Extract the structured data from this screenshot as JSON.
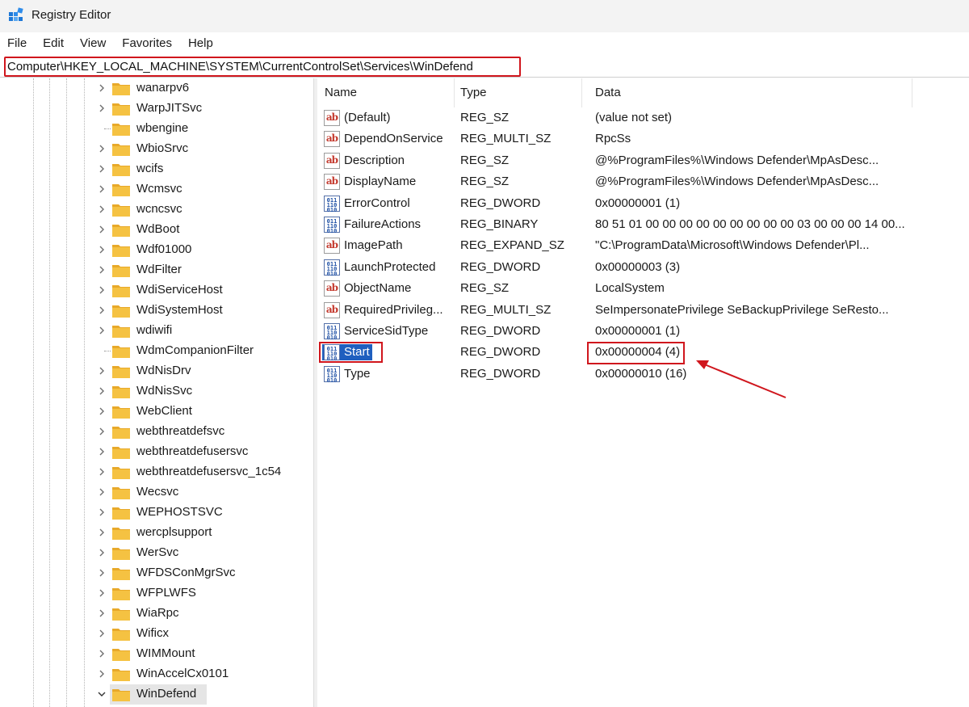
{
  "window": {
    "title": "Registry Editor",
    "icon": "registry-editor-icon"
  },
  "menu": [
    "File",
    "Edit",
    "View",
    "Favorites",
    "Help"
  ],
  "address": {
    "value": "Computer\\HKEY_LOCAL_MACHINE\\SYSTEM\\CurrentControlSet\\Services\\WinDefend"
  },
  "tree": {
    "items": [
      {
        "label": "wanarpv6",
        "expandable": true
      },
      {
        "label": "WarpJITSvc",
        "expandable": true
      },
      {
        "label": "wbengine",
        "expandable": false
      },
      {
        "label": "WbioSrvc",
        "expandable": true
      },
      {
        "label": "wcifs",
        "expandable": true
      },
      {
        "label": "Wcmsvc",
        "expandable": true
      },
      {
        "label": "wcncsvc",
        "expandable": true
      },
      {
        "label": "WdBoot",
        "expandable": true
      },
      {
        "label": "Wdf01000",
        "expandable": true
      },
      {
        "label": "WdFilter",
        "expandable": true
      },
      {
        "label": "WdiServiceHost",
        "expandable": true
      },
      {
        "label": "WdiSystemHost",
        "expandable": true
      },
      {
        "label": "wdiwifi",
        "expandable": true
      },
      {
        "label": "WdmCompanionFilter",
        "expandable": false
      },
      {
        "label": "WdNisDrv",
        "expandable": true
      },
      {
        "label": "WdNisSvc",
        "expandable": true
      },
      {
        "label": "WebClient",
        "expandable": true
      },
      {
        "label": "webthreatdefsvc",
        "expandable": true
      },
      {
        "label": "webthreatdefusersvc",
        "expandable": true
      },
      {
        "label": "webthreatdefusersvc_1c54",
        "expandable": true
      },
      {
        "label": "Wecsvc",
        "expandable": true
      },
      {
        "label": "WEPHOSTSVC",
        "expandable": true
      },
      {
        "label": "wercplsupport",
        "expandable": true
      },
      {
        "label": "WerSvc",
        "expandable": true
      },
      {
        "label": "WFDSConMgrSvc",
        "expandable": true
      },
      {
        "label": "WFPLWFS",
        "expandable": true
      },
      {
        "label": "WiaRpc",
        "expandable": true
      },
      {
        "label": "Wificx",
        "expandable": true
      },
      {
        "label": "WIMMount",
        "expandable": true
      },
      {
        "label": "WinAccelCx0101",
        "expandable": true
      },
      {
        "label": "WinDefend",
        "expandable": true,
        "expanded": true,
        "selected": true
      }
    ]
  },
  "list": {
    "columns": [
      "Name",
      "Type",
      "Data"
    ],
    "rows": [
      {
        "name": "(Default)",
        "type": "REG_SZ",
        "data": "(value not set)",
        "icon": "string-value-icon"
      },
      {
        "name": "DependOnService",
        "type": "REG_MULTI_SZ",
        "data": "RpcSs",
        "icon": "string-value-icon"
      },
      {
        "name": "Description",
        "type": "REG_SZ",
        "data": "@%ProgramFiles%\\Windows Defender\\MpAsDesc...",
        "icon": "string-value-icon"
      },
      {
        "name": "DisplayName",
        "type": "REG_SZ",
        "data": "@%ProgramFiles%\\Windows Defender\\MpAsDesc...",
        "icon": "string-value-icon"
      },
      {
        "name": "ErrorControl",
        "type": "REG_DWORD",
        "data": "0x00000001 (1)",
        "icon": "binary-value-icon"
      },
      {
        "name": "FailureActions",
        "type": "REG_BINARY",
        "data": "80 51 01 00 00 00 00 00 00 00 00 00 03 00 00 00 14 00...",
        "icon": "binary-value-icon"
      },
      {
        "name": "ImagePath",
        "type": "REG_EXPAND_SZ",
        "data": "\"C:\\ProgramData\\Microsoft\\Windows Defender\\Pl...",
        "icon": "string-value-icon"
      },
      {
        "name": "LaunchProtected",
        "type": "REG_DWORD",
        "data": "0x00000003 (3)",
        "icon": "binary-value-icon"
      },
      {
        "name": "ObjectName",
        "type": "REG_SZ",
        "data": "LocalSystem",
        "icon": "string-value-icon"
      },
      {
        "name": "RequiredPrivileg...",
        "type": "REG_MULTI_SZ",
        "data": "SeImpersonatePrivilege SeBackupPrivilege SeResto...",
        "icon": "string-value-icon"
      },
      {
        "name": "ServiceSidType",
        "type": "REG_DWORD",
        "data": "0x00000001 (1)",
        "icon": "binary-value-icon"
      },
      {
        "name": "Start",
        "type": "REG_DWORD",
        "data": "0x00000004 (4)",
        "icon": "binary-value-icon",
        "selected": true,
        "highlighted": true
      },
      {
        "name": "Type",
        "type": "REG_DWORD",
        "data": "0x00000010 (16)",
        "icon": "binary-value-icon"
      }
    ]
  },
  "colors": {
    "highlight_box": "#d0161d",
    "selection": "#1f5fbf",
    "folder": "#f5c242"
  }
}
